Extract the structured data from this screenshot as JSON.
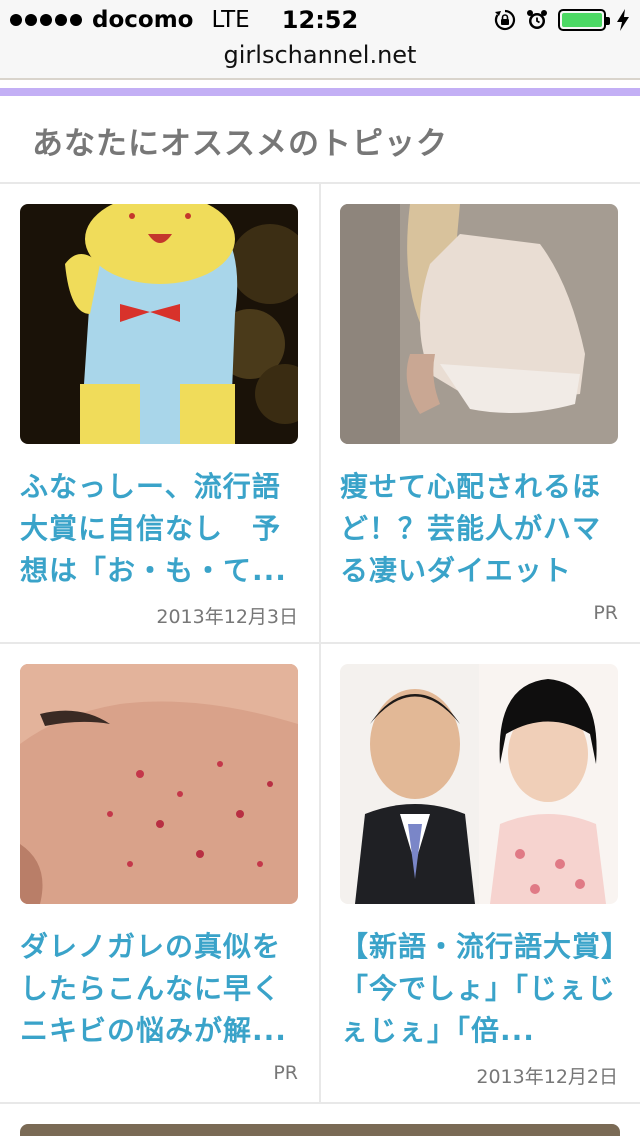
{
  "status_bar": {
    "carrier": "docomo",
    "network": "LTE",
    "time": "12:52",
    "battery_level": 1.0,
    "icons": [
      "signal-dots-icon",
      "rotation-lock-icon",
      "alarm-icon",
      "battery-icon",
      "charging-bolt-icon"
    ]
  },
  "browser": {
    "url": "girlschannel.net"
  },
  "section": {
    "title": "あなたにオススメのトピック"
  },
  "colors": {
    "accent_bar": "#c3aff5",
    "title_link": "#3aa3c9",
    "battery": "#4cd964"
  },
  "cards": [
    {
      "title": "ふなっしー、流行語大賞に自信なし　予想は「お・も・て...",
      "meta": "2013年12月3日",
      "image": "mascot-costume-photo"
    },
    {
      "title": "痩せて心配されるほど！？芸能人がハマる凄いダイエット",
      "meta": "PR",
      "image": "diet-ad-photo"
    },
    {
      "title": "ダレノガレの真似をしたらこんなに早くニキビの悩みが解...",
      "meta": "PR",
      "image": "acne-skin-photo"
    },
    {
      "title": "【新語・流行語大賞】「今でしょ」「じぇじぇじぇ」「倍...",
      "meta": "2013年12月2日",
      "image": "celebrities-photo"
    }
  ]
}
